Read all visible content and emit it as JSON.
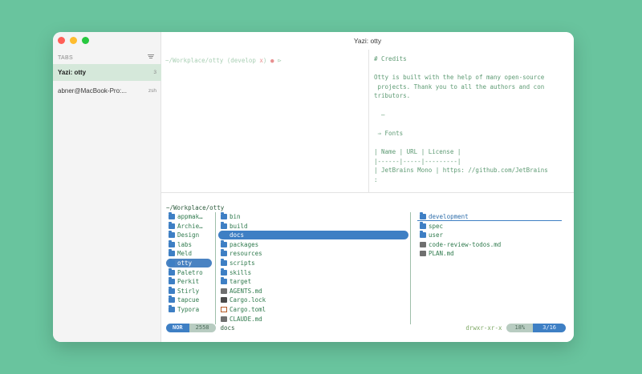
{
  "window": {
    "title": "Yazi: otty"
  },
  "sidebar": {
    "tabs_label": "TABS",
    "tabs": [
      {
        "label": "Yazi: otty",
        "index": "3"
      },
      {
        "label": "abner@MacBook-Pro:...",
        "index": "zsh"
      }
    ]
  },
  "terminal": {
    "prompt_path": "~/Workplace/otty",
    "prompt_branch": "(develop ",
    "prompt_dirty": "x",
    "prompt_close": ")",
    "prompt_dot": "●",
    "prompt_arrow": "⊳"
  },
  "preview": {
    "lines": [
      "# Credits",
      "",
      "Otty is built with the help of many open-source",
      " projects. Thank you to all the authors and con",
      "tributors.",
      "",
      "  —",
      "",
      " ⇒ Fonts",
      "",
      "| Name | URL | License |",
      "|------|-----|---------|",
      "| JetBrains Mono | https: //github.com/JetBrains",
      ":"
    ]
  },
  "yazi": {
    "cwd": "~/Workplace/otty",
    "parent": [
      {
        "name": "appmak…",
        "type": "folder"
      },
      {
        "name": "Archie…",
        "type": "folder"
      },
      {
        "name": "Design",
        "type": "folder"
      },
      {
        "name": "labs",
        "type": "folder"
      },
      {
        "name": "Meld",
        "type": "folder"
      },
      {
        "name": "otty",
        "type": "folder",
        "selected": true
      },
      {
        "name": "Paletro",
        "type": "folder"
      },
      {
        "name": "Perkit",
        "type": "folder"
      },
      {
        "name": "Stirly",
        "type": "folder"
      },
      {
        "name": "tapcue",
        "type": "folder"
      },
      {
        "name": "Typora",
        "type": "folder"
      }
    ],
    "current": [
      {
        "name": "bin",
        "type": "folder"
      },
      {
        "name": "build",
        "type": "folder"
      },
      {
        "name": "docs",
        "type": "folder",
        "selected": true
      },
      {
        "name": "packages",
        "type": "folder"
      },
      {
        "name": "resources",
        "type": "folder"
      },
      {
        "name": "scripts",
        "type": "folder"
      },
      {
        "name": "skills",
        "type": "folder"
      },
      {
        "name": "target",
        "type": "folder"
      },
      {
        "name": "AGENTS.md",
        "type": "md"
      },
      {
        "name": "Cargo.lock",
        "type": "lock"
      },
      {
        "name": "Cargo.toml",
        "type": "toml"
      },
      {
        "name": "CLAUDE.md",
        "type": "md"
      }
    ],
    "preview": [
      {
        "name": "development",
        "type": "folder",
        "hover": true
      },
      {
        "name": "spec",
        "type": "folder"
      },
      {
        "name": "user",
        "type": "folder"
      },
      {
        "name": "code-review-todos.md",
        "type": "md"
      },
      {
        "name": "PLAN.md",
        "type": "md"
      }
    ],
    "status": {
      "mode": "NOR",
      "size": "2558",
      "name": "docs",
      "perm": "drwxr-xr-x",
      "percent": "18%",
      "position": "3/16"
    }
  },
  "colors": {
    "background": "#69c49e",
    "accent": "#3e7fc4",
    "active_tab": "#d5e8da"
  }
}
